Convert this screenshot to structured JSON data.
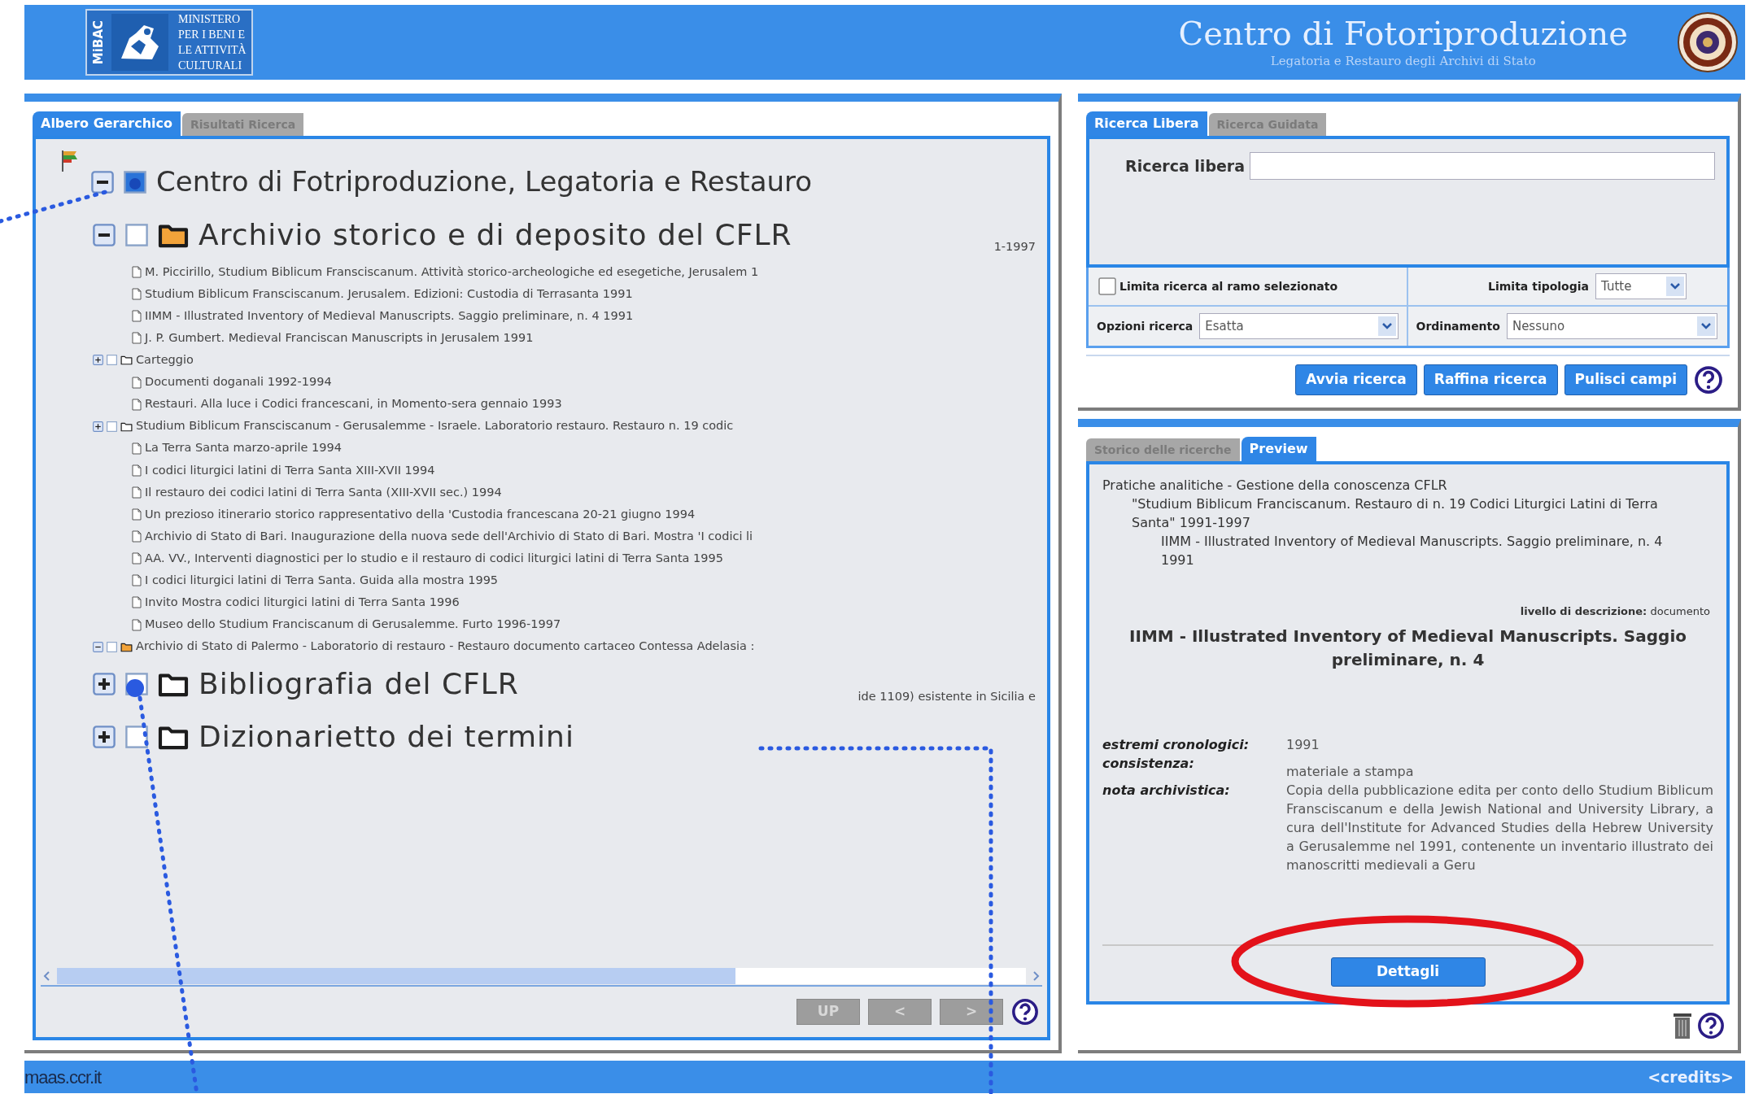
{
  "header": {
    "badge": "MiBAC",
    "ministry_lines": [
      "MINISTERO",
      "PER I BENI E",
      "LE ATTIVITÀ",
      "CULTURALI"
    ],
    "title": "Centro di Fotoriproduzione",
    "subtitle": "Legatoria e Restauro degli Archivi di Stato"
  },
  "tree_panel": {
    "tabs": [
      {
        "label": "Albero Gerarchico",
        "selected": true
      },
      {
        "label": "Risultati Ricerca",
        "selected": false
      }
    ],
    "tree": [
      {
        "kind": "root",
        "title": "Centro di Fotriproduzione, Legatoria e Restauro",
        "magnified": true,
        "expanded": true,
        "checked": true,
        "children": [
          {
            "kind": "folder",
            "title": "Archivio storico e di deposito del CFLR",
            "magnified": true,
            "expanded": true,
            "checked": false,
            "fragment": "1-1997",
            "children": [
              {
                "kind": "document",
                "title": "M. Piccirillo, Studium Biblicum Fransciscanum. Attività storico-archeologiche ed esegetiche, Jerusalem 1"
              },
              {
                "kind": "document",
                "title": "Studium Biblicum Fransciscanum. Jerusalem. Edizioni: Custodia di Terrasanta 1991"
              },
              {
                "kind": "document",
                "title": "IIMM - Illustrated Inventory of Medieval Manuscripts. Saggio preliminare, n. 4 1991"
              },
              {
                "kind": "document",
                "title": "J. P. Gumbert. Medieval Franciscan Manuscripts in Jerusalem 1991"
              },
              {
                "kind": "folder",
                "title": "Carteggio",
                "magnified": false,
                "expanded": false,
                "checked": false
              },
              {
                "kind": "document",
                "title": "Documenti doganali 1992-1994"
              },
              {
                "kind": "document",
                "title": "Restauri. Alla luce i Codici francescani, in Momento-sera gennaio 1993"
              },
              {
                "kind": "folder",
                "title": "Studium Biblicum Fransciscanum - Gerusalemme - Israele. Laboratorio restauro. Restauro n. 19 codic",
                "magnified": false,
                "expanded": false,
                "checked": false
              },
              {
                "kind": "document",
                "title": "La Terra Santa marzo-aprile 1994"
              },
              {
                "kind": "document",
                "title": "I codici liturgici latini di Terra Santa XIII-XVII 1994"
              },
              {
                "kind": "document",
                "title": "Il restauro dei codici latini di Terra Santa (XIII-XVII sec.) 1994"
              },
              {
                "kind": "document",
                "title": "Un prezioso itinerario storico rappresentativo della 'Custodia francescana 20-21 giugno 1994"
              },
              {
                "kind": "document",
                "title": "Archivio di Stato di Bari. Inaugurazione della nuova sede dell'Archivio di Stato di Bari. Mostra 'I codici li"
              },
              {
                "kind": "document",
                "title": "AA. VV., Interventi diagnostici per lo studio e il restauro di codici liturgici latini di Terra Santa 1995"
              },
              {
                "kind": "document",
                "title": "I codici liturgici latini di Terra Santa. Guida alla mostra 1995"
              },
              {
                "kind": "document",
                "title": "Invito Mostra codici liturgici latini di Terra Santa 1996"
              },
              {
                "kind": "document",
                "title": "Museo dello Studium Franciscanum di Gerusalemme. Furto 1996-1997"
              },
              {
                "kind": "folder",
                "title": "Archivio di Stato di Palermo - Laboratorio di restauro - Restauro documento cartaceo Contessa Adelasia :",
                "magnified": false,
                "expanded": true,
                "checked": false
              }
            ]
          },
          {
            "kind": "folder",
            "title": "Bibliografia del CFLR",
            "magnified": true,
            "expanded": false,
            "checked": false,
            "fragment": "ide 1109) esistente in Sicilia e"
          },
          {
            "kind": "folder",
            "title": "Dizionarietto dei termini",
            "magnified": true,
            "expanded": false,
            "checked": false
          }
        ]
      }
    ],
    "nav_buttons": [
      {
        "label": "UP",
        "disabled": true
      },
      {
        "label": "<",
        "disabled": true
      },
      {
        "label": ">",
        "disabled": true
      }
    ]
  },
  "search_panel": {
    "tabs": [
      {
        "label": "Ricerca Libera",
        "selected": true
      },
      {
        "label": "Ricerca Guidata",
        "selected": false
      }
    ],
    "free_search": {
      "label": "Ricerca libera"
    },
    "limit_branch": {
      "label": "Limita ricerca al ramo selezionato",
      "checked": false
    },
    "limit_type": {
      "label": "Limita tipologia",
      "value": "Tutte"
    },
    "search_options": {
      "label": "Opzioni ricerca",
      "value": "Esatta"
    },
    "ordering": {
      "label": "Ordinamento",
      "value": "Nessuno"
    },
    "buttons": [
      "Avvia ricerca",
      "Raffina ricerca",
      "Pulisci campi"
    ]
  },
  "preview_panel": {
    "tabs": [
      {
        "label": "Storico delle ricerche",
        "selected": false
      },
      {
        "label": "Preview",
        "selected": true
      }
    ],
    "path": [
      {
        "text": "Pratiche analitiche - Gestione della conoscenza CFLR",
        "children": [
          {
            "text": "\"Studium Biblicum Franciscanum. Restauro di n. 19 Codici Liturgici Latini di Terra Santa\" 1991-1997",
            "children": [
              {
                "text": "IIMM - Illustrated Inventory of Medieval Manuscripts. Saggio preliminare, n. 4 1991"
              }
            ]
          }
        ]
      }
    ],
    "level": "**livello di descrizione:** documento",
    "title": "IIMM - Illustrated Inventory of Medieval Manuscripts. Saggio preliminare, n. 4",
    "fields": [
      {
        "label": "estremi cronologici:",
        "value": "1991"
      },
      {
        "label": "consistenza:",
        "value": "materiale a stampa"
      },
      {
        "label": "nota archivistica:",
        "value": "Copia della pubblicazione edita per conto dello Studium Biblicum Fransciscanum e della Jewish National and University Library, a cura dell'Institute for Advanced Studies della Hebrew University a Gerusalemme nel 1991, contenente un inventario illustrato dei manoscritti medievali a Geru"
      }
    ],
    "details_button": "Dettagli"
  },
  "footer": {
    "site": "maas.ccr.it",
    "credits": "<credits>"
  }
}
